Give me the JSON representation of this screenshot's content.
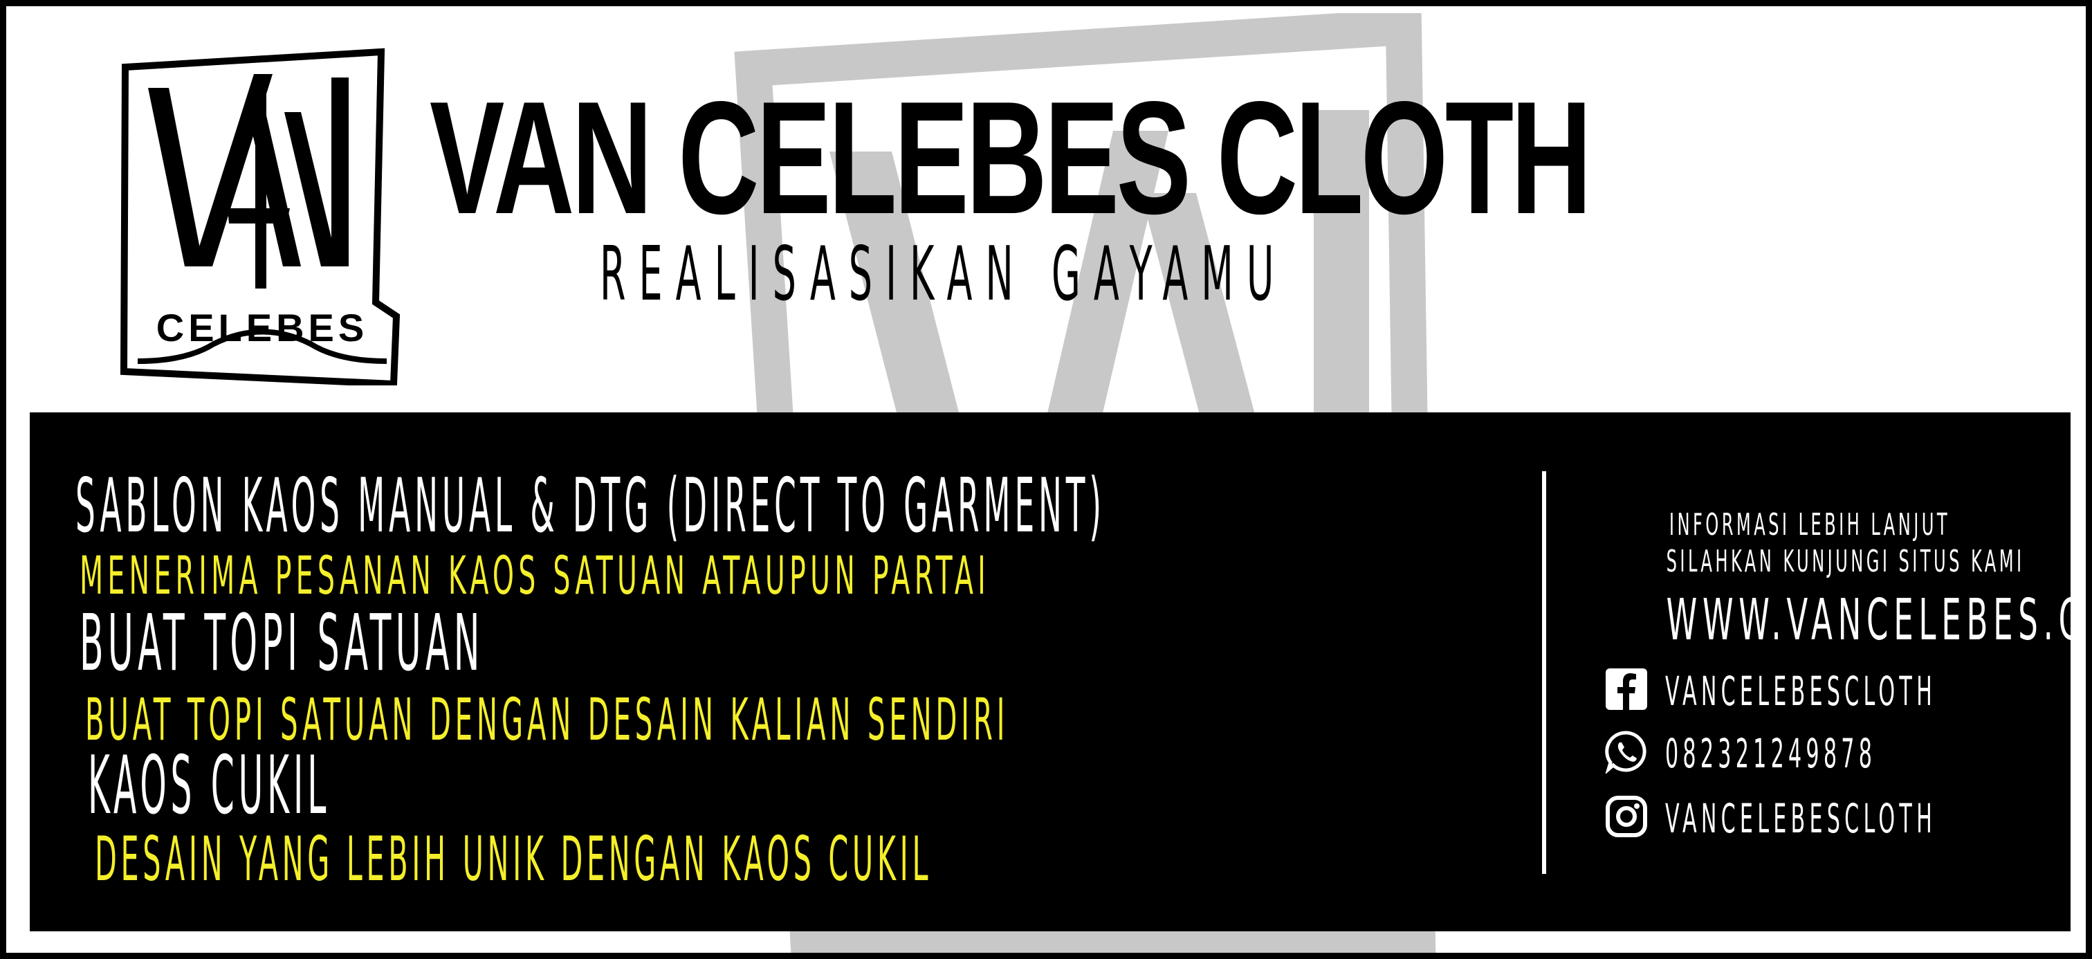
{
  "brand": {
    "logo_text_top": "VAN",
    "logo_text_bottom": "CELEBES",
    "title": "VAN CELEBES CLOTH",
    "tagline": "REALISASIKAN GAYAMU"
  },
  "services": [
    {
      "text": "SABLON KAOS MANUAL & DTG (DIRECT TO GARMENT)",
      "color": "white"
    },
    {
      "text": "MENERIMA PESANAN KAOS SATUAN ATAUPUN PARTAI",
      "color": "yellow"
    },
    {
      "text": "BUAT TOPI SATUAN",
      "color": "white"
    },
    {
      "text": "BUAT TOPI SATUAN DENGAN DESAIN KALIAN SENDIRI",
      "color": "yellow"
    },
    {
      "text": "KAOS CUKIL",
      "color": "white"
    },
    {
      "text": "DESAIN YANG LEBIH UNIK DENGAN KAOS CUKIL",
      "color": "yellow"
    }
  ],
  "info": {
    "line1": "INFORMASI LEBIH LANJUT",
    "line2": "SILAHKAN KUNJUNGI SITUS KAMI",
    "website": "WWW.VANCELEBES.COM"
  },
  "social": [
    {
      "icon": "facebook-icon",
      "text": "VANCELEBESCLOTH"
    },
    {
      "icon": "whatsapp-icon",
      "text": "082321249878"
    },
    {
      "icon": "instagram-icon",
      "text": "VANCELEBESCLOTH"
    }
  ],
  "colors": {
    "background": "#ffffff",
    "panel": "#000000",
    "accent_yellow": "#f4ef2a",
    "watermark_gray": "#c8c8c8"
  }
}
